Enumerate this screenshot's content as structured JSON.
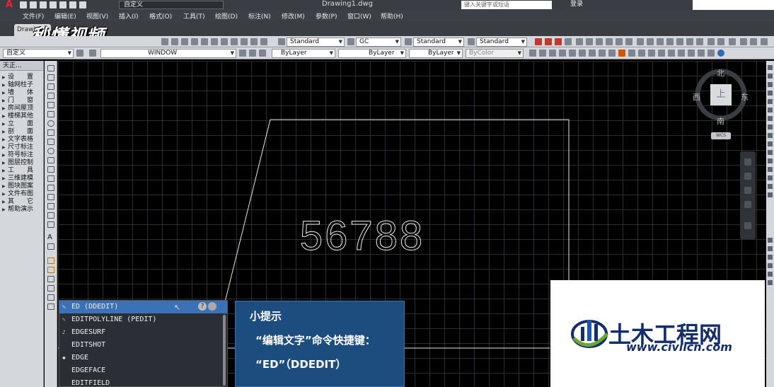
{
  "title_bar": {
    "logo": "A",
    "workspace": "自定义",
    "document_title": "Drawing1.dwg",
    "search_placeholder": "键入关键字或短语",
    "login": "登录"
  },
  "menu": [
    "文件(F)",
    "编辑(E)",
    "视图(V)",
    "插入(I)",
    "格式(O)",
    "工具(T)",
    "绘图(D)",
    "标注(N)",
    "修改(M)",
    "参数(P)",
    "窗口(W)",
    "帮助(H)"
  ],
  "doc_tab": "Drawi",
  "watermark_top": "秒懂视频",
  "toolbar1": {
    "text_style": "Standard",
    "dim_style": "GC",
    "table_style": "Standard",
    "multileader_style": "Standard"
  },
  "toolbar2": {
    "workspace": "自定义",
    "layer": "WINDOW",
    "color": "ByLayer",
    "linetype": "ByLayer",
    "lineweight": "ByLayer",
    "plot_style": "ByColor"
  },
  "tianzheng": {
    "header": "天正...",
    "items": [
      "设　　置",
      "轴网柱子",
      "墙　　体",
      "门　　窗",
      "房间屋顶",
      "楼梯其他",
      "立　　面",
      "剖　　面",
      "文字表格",
      "尺寸标注",
      "符号标注",
      "图层控制",
      "工　　具",
      "三维建模",
      "图块图案",
      "文件布图",
      "其　　它",
      "帮助演示"
    ]
  },
  "viewcube": {
    "north": "北",
    "south": "南",
    "east": "东",
    "west": "西",
    "face": "上",
    "ucs": "WCS"
  },
  "drawing": {
    "text": "56788"
  },
  "autocomplete": {
    "items": [
      "ED (DDEDIT)",
      "EDITPOLYLINE (PEDIT)",
      "EDGESURF",
      "EDITSHOT",
      "EDGE",
      "EDGEFACE",
      "EDITFIELD"
    ],
    "help": "?"
  },
  "tip": {
    "title": "小提示",
    "line1": "“编辑文字”命令快捷键：",
    "line2": "“ED”（DDEDIT）"
  },
  "watermark_bottom": {
    "name": "土木工程网",
    "url": "www.civilcn.com"
  },
  "colors": {
    "canvas": "#000000",
    "tip_box": "#1d4c7e",
    "selection": "#3b71b6",
    "logo_blue": "#142d6b",
    "logo_green": "#6aa832"
  }
}
